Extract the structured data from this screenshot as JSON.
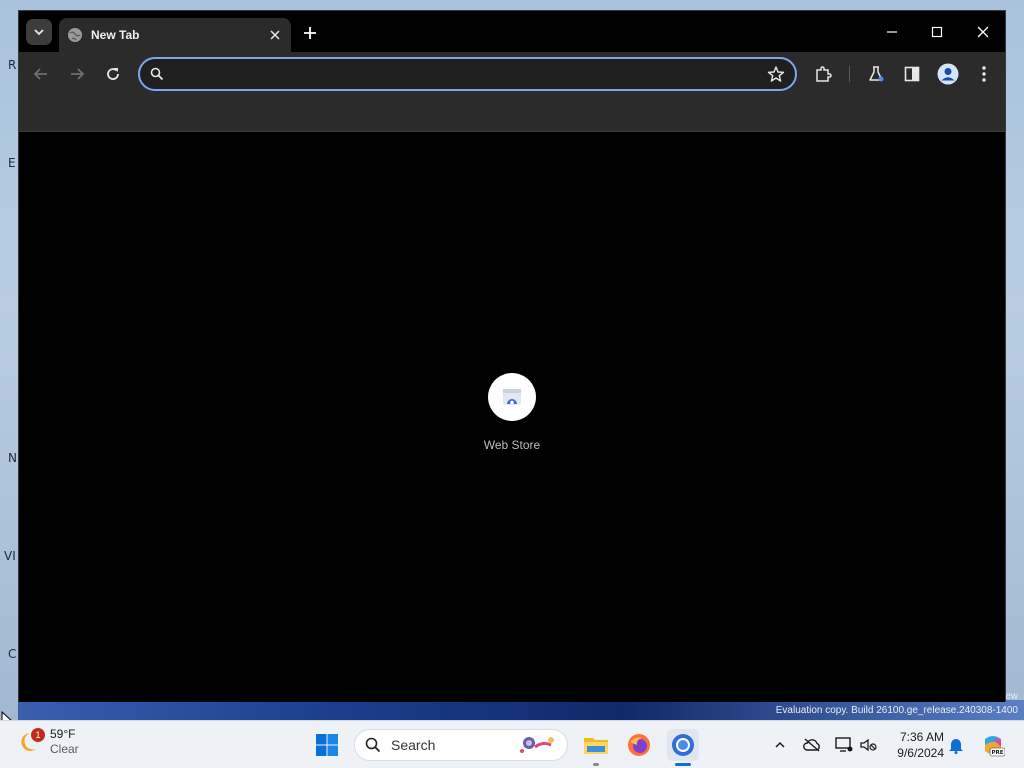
{
  "browser": {
    "tab": {
      "title": "New Tab"
    },
    "omnibox": {
      "value": "",
      "placeholder": ""
    },
    "shortcuts": [
      {
        "label": "Web Store"
      }
    ],
    "colors": {
      "frame": "#000000",
      "toolbar": "#2b2b2b",
      "omnibox_focus": "#7ca7f0"
    }
  },
  "desktop": {
    "edge_letters": [
      "R",
      "E",
      "N",
      "VI",
      "C"
    ],
    "watermark_line1": "ew",
    "watermark_line2": "Evaluation copy. Build 26100.ge_release.240308-1400"
  },
  "taskbar": {
    "weather": {
      "temp": "59°F",
      "condition": "Clear",
      "badge": "1"
    },
    "search_label": "Search",
    "clock": {
      "time": "7:36 AM",
      "date": "9/6/2024"
    },
    "copilot_badge": "PRE"
  }
}
